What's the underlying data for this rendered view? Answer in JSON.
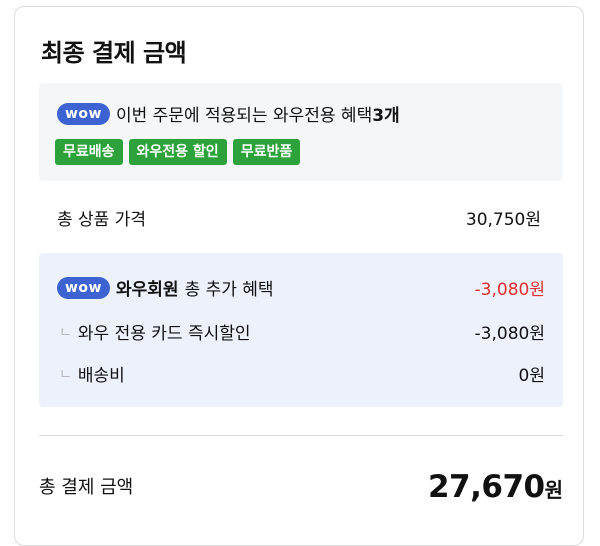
{
  "title": "최종 결제 금액",
  "benefits": {
    "badge": "wow",
    "text": "이번 주문에 적용되는 와우전용 혜택",
    "count": "3개",
    "tags": [
      "무료배송",
      "와우전용 할인",
      "무료반품"
    ]
  },
  "total_price": {
    "label": "총 상품 가격",
    "value": "30,750원"
  },
  "wow_section": {
    "badge": "wow",
    "member_label": "와우회원",
    "benefit_label": "총 추가 혜택",
    "benefit_value": "-3,080원",
    "items": [
      {
        "mark": "ㄴ",
        "label": "와우 전용 카드 즉시할인",
        "value": "-3,080원"
      },
      {
        "mark": "ㄴ",
        "label": "배송비",
        "value": "0원"
      }
    ]
  },
  "final": {
    "label": "총 결제 금액",
    "amount": "27,670",
    "unit": "원"
  },
  "colors": {
    "wow_badge": "#3d62d1",
    "tag_green": "#2ea23a",
    "discount_red": "#e03030",
    "wow_bg": "#edf1fc"
  }
}
